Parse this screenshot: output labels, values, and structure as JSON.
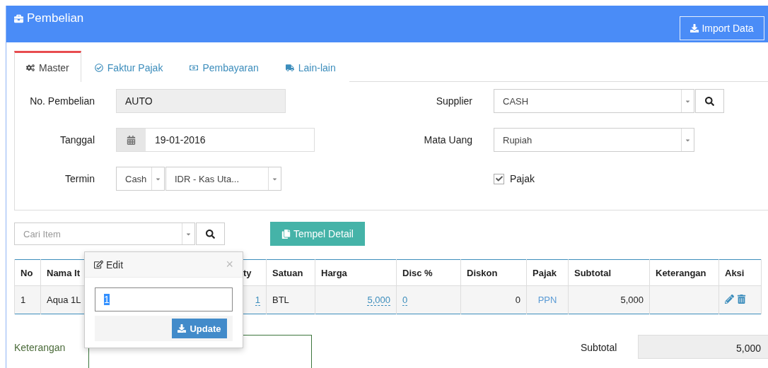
{
  "page": {
    "title": "Pembelian",
    "import_button": "Import Data"
  },
  "tabs": [
    {
      "label": "Master",
      "selected": true
    },
    {
      "label": "Faktur Pajak",
      "selected": false
    },
    {
      "label": "Pembayaran",
      "selected": false
    },
    {
      "label": "Lain-lain",
      "selected": false
    }
  ],
  "form": {
    "left": [
      {
        "label": "No. Pembelian",
        "kind": "readonly",
        "value": "AUTO"
      },
      {
        "label": "Tanggal",
        "kind": "date",
        "value": "19-01-2016"
      },
      {
        "label": "Termin",
        "kind": "double_select",
        "values": [
          "Cash",
          "IDR - Kas Uta..."
        ]
      }
    ],
    "right": [
      {
        "label": "Supplier",
        "kind": "select_search",
        "value": "CASH"
      },
      {
        "label": "Mata Uang",
        "kind": "select",
        "value": "Rupiah"
      },
      {
        "label": "Pajak",
        "kind": "checkbox",
        "checked": true
      }
    ]
  },
  "item_search": {
    "placeholder": "Cari Item"
  },
  "paste_button": "Tempel Detail",
  "table": {
    "columns": [
      "No",
      "Nama It",
      "ty",
      "Satuan",
      "Harga",
      "Disc %",
      "Diskon",
      "Pajak",
      "Subtotal",
      "Keterangan",
      "Aksi"
    ],
    "rows": [
      {
        "no": "1",
        "item": "Aqua 1L",
        "qty": "1",
        "unit": "BTL",
        "price": "5,000",
        "disc_pct": "0",
        "discount": "0",
        "tax": "PPN",
        "subtotal": "5,000"
      }
    ]
  },
  "popover": {
    "title": "Edit",
    "close": "×",
    "value": "1",
    "button": "Update"
  },
  "footer": {
    "note_label": "Keterangan",
    "subtotal_label": "Subtotal",
    "subtotal_value": "5,000"
  }
}
